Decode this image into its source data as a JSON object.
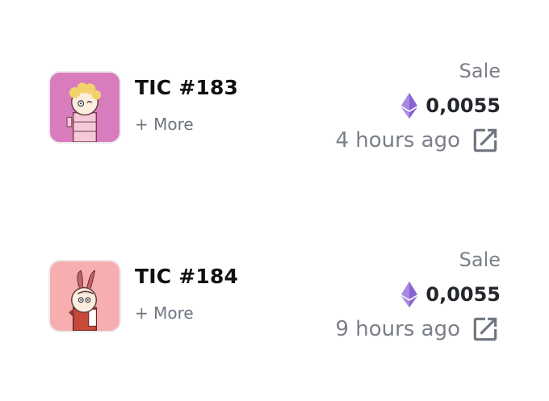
{
  "activity": {
    "items": [
      {
        "name": "TIC #183",
        "more_label": "+ More",
        "type": "Sale",
        "price": "0,0055",
        "currency_icon": "ethereum-icon",
        "time": "4 hours ago",
        "link_icon": "open-in-new-icon",
        "thumb_bg": "#d97cbd"
      },
      {
        "name": "TIC #184",
        "more_label": "+ More",
        "type": "Sale",
        "price": "0,0055",
        "currency_icon": "ethereum-icon",
        "time": "9 hours ago",
        "link_icon": "open-in-new-icon",
        "thumb_bg": "#f7aeb0"
      }
    ]
  },
  "colors": {
    "title": "#111111",
    "muted": "#7a7f88",
    "ethereum": "#8a63d2"
  }
}
